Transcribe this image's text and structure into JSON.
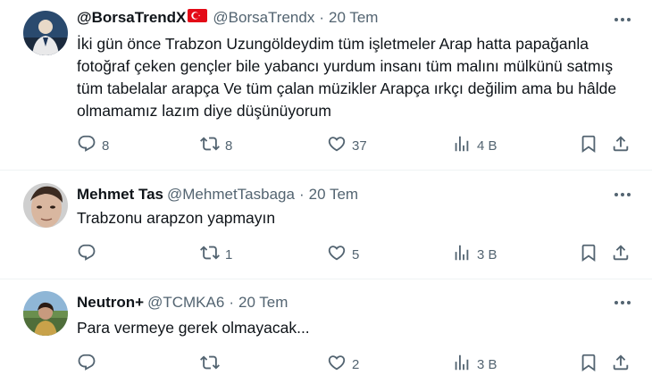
{
  "tweets": [
    {
      "name": "@BorsaTrendX",
      "has_flag": true,
      "handle": "@BorsaTrendx",
      "time": "20 Tem",
      "text": "İki gün önce Trabzon Uzungöldeydim tüm işletmeler Arap hatta papağanla fotoğraf çeken gençler bile yabancı yurdum insanı tüm malını mülkünü satmış tüm tabelalar arapça Ve tüm çalan müzikler Arapça ırkçı değilim ama bu hâlde olmamamız lazım diye düşünüyorum",
      "replies": "8",
      "retweets": "8",
      "likes": "37",
      "views": "4 B"
    },
    {
      "name": "Mehmet Tas",
      "handle": "@MehmetTasbaga",
      "time": "20 Tem",
      "text": "Trabzonu arapzon yapmayın",
      "replies": "",
      "retweets": "1",
      "likes": "5",
      "views": "3 B"
    },
    {
      "name": "Neutron+",
      "handle": "@TCMKA6",
      "time": "20 Tem",
      "text": "Para vermeye gerek olmayacak...",
      "replies": "",
      "retweets": "",
      "likes": "2",
      "views": "3 B"
    }
  ],
  "colors": {
    "text": "#0f1419",
    "secondary": "#536471",
    "divider": "#eff3f4",
    "flag_red": "#e30a17"
  },
  "icons": [
    "reply-icon",
    "retweet-icon",
    "like-icon",
    "views-icon",
    "bookmark-icon",
    "share-icon",
    "more-icon",
    "turkish-flag-icon"
  ]
}
